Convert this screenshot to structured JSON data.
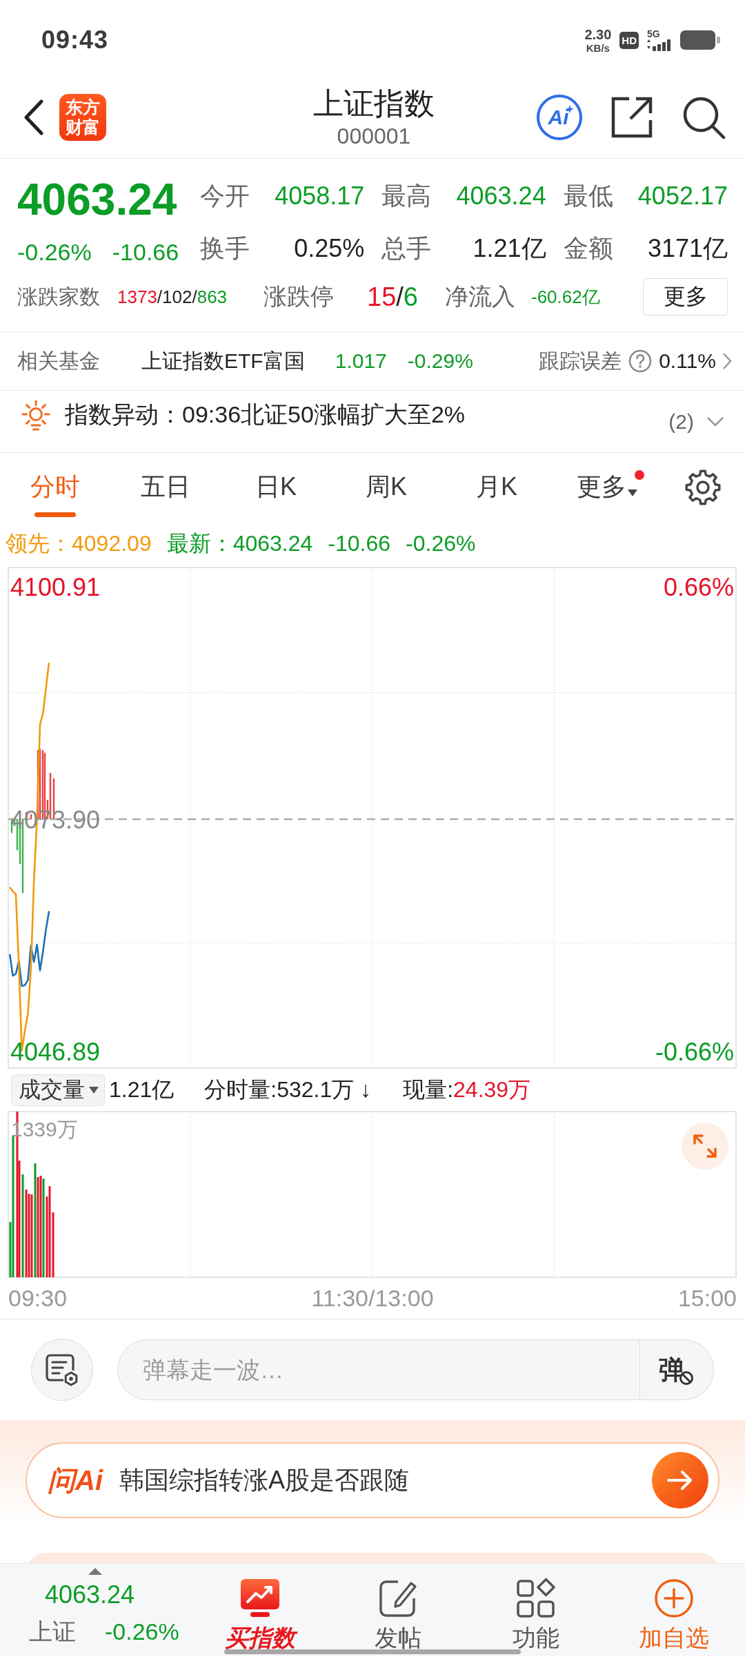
{
  "status_bar": {
    "time": "09:43",
    "net_speed": "2.30",
    "net_unit": "KB/s",
    "hd": "HD",
    "network": "5G"
  },
  "header": {
    "logo": "东方财富",
    "title": "上证指数",
    "code": "000001",
    "ai_label": "Ai"
  },
  "quote": {
    "price": "4063.24",
    "change_pct": "-0.26%",
    "change": "-10.66",
    "kind": "down",
    "stats": [
      {
        "label": "今开",
        "value": "4058.17",
        "kind": "down"
      },
      {
        "label": "最高",
        "value": "4063.24",
        "kind": "down"
      },
      {
        "label": "最低",
        "value": "4052.17",
        "kind": "down"
      },
      {
        "label": "换手",
        "value": "0.25%",
        "kind": "neutral"
      },
      {
        "label": "总手",
        "value": "1.21亿",
        "kind": "neutral"
      },
      {
        "label": "金额",
        "value": "3171亿",
        "kind": "neutral"
      }
    ],
    "breadth": {
      "label": "涨跌家数",
      "parts": [
        {
          "text": "1373",
          "kind": "up"
        },
        {
          "text": "/102/",
          "kind": "neutral"
        },
        {
          "text": "863",
          "kind": "down"
        }
      ]
    },
    "limits": {
      "label": "涨跌停",
      "parts": [
        {
          "text": "15",
          "kind": "up"
        },
        {
          "text": "/",
          "kind": "neutral"
        },
        {
          "text": "6",
          "kind": "down"
        }
      ]
    },
    "net_inflow": {
      "label": "净流入",
      "value": "-60.62亿",
      "kind": "down"
    },
    "more_button": "更多"
  },
  "related_fund": {
    "label": "相关基金",
    "name": "上证指数ETF富国",
    "price": "1.017",
    "change": "-0.29%",
    "kind": "down",
    "tracking_label": "跟踪误差",
    "tracking_value": "0.11%"
  },
  "alert": {
    "text": "指数异动：09:36北证50涨幅扩大至2%",
    "count": "(2)",
    "expanded": false
  },
  "tabs": [
    {
      "label": "分时",
      "selected": true,
      "kind": "period",
      "notification": false
    },
    {
      "label": "五日",
      "selected": false,
      "kind": "period",
      "notification": false
    },
    {
      "label": "日K",
      "selected": false,
      "kind": "period",
      "notification": false
    },
    {
      "label": "周K",
      "selected": false,
      "kind": "period",
      "notification": false
    },
    {
      "label": "月K",
      "selected": false,
      "kind": "period",
      "notification": false
    },
    {
      "label": "更多",
      "selected": false,
      "kind": "menu",
      "notification": true
    }
  ],
  "legend": [
    {
      "text": "领先：4092.09",
      "kind": "lead"
    },
    {
      "text": "最新：4063.24",
      "kind": "down"
    },
    {
      "text": "-10.66",
      "kind": "down"
    },
    {
      "text": "-0.26%",
      "kind": "down"
    }
  ],
  "price_chart": {
    "chart_data": {
      "type": "line",
      "categories": [
        null,
        null,
        null,
        null,
        null,
        null,
        null,
        null,
        null,
        null,
        null,
        null,
        null,
        null,
        null,
        null,
        null,
        null,
        null,
        null,
        null,
        null,
        null,
        null,
        null,
        null,
        null,
        null,
        null,
        null,
        null,
        null,
        null,
        null,
        null,
        null,
        null,
        null,
        null,
        null,
        null,
        null,
        null,
        null,
        null,
        null,
        null,
        null,
        null,
        null,
        null,
        null,
        null,
        null,
        null,
        null,
        null,
        null,
        null,
        null,
        null,
        null,
        null,
        null,
        null,
        null,
        null,
        null,
        null,
        null,
        null,
        null,
        null,
        null,
        null,
        null,
        null,
        null,
        null,
        null,
        null,
        null,
        null,
        null,
        null,
        null,
        null,
        null,
        null,
        null,
        null,
        null,
        null,
        null,
        null,
        null,
        null,
        null,
        null,
        null,
        null,
        null,
        null,
        null,
        null,
        null,
        null,
        null,
        null,
        null,
        null,
        null,
        null,
        null,
        null,
        null,
        null,
        null,
        null,
        null,
        null,
        null,
        null,
        null,
        null,
        null,
        null,
        null,
        null,
        null,
        null,
        null,
        null,
        null,
        null,
        null,
        null,
        null,
        null,
        null,
        null,
        null,
        null,
        null,
        null,
        null,
        null,
        null,
        null,
        null,
        null,
        null,
        null,
        null,
        null,
        null,
        null,
        null,
        null,
        null,
        null,
        null,
        null,
        null,
        null,
        null,
        null,
        null,
        null,
        null,
        null,
        null,
        null,
        null,
        null,
        null,
        null,
        null,
        null,
        null,
        null,
        null,
        null,
        null,
        null,
        null,
        null,
        null,
        null,
        null,
        null,
        null,
        null,
        null,
        null,
        null,
        null,
        null,
        null,
        null,
        null,
        null,
        null,
        null,
        null,
        null,
        null,
        null,
        null,
        null,
        null,
        null,
        null,
        null,
        null,
        null,
        null,
        null,
        null,
        null,
        null,
        null,
        null,
        null,
        null,
        null,
        null,
        null,
        null,
        null,
        null,
        null,
        null,
        null,
        null,
        null,
        null,
        null,
        null,
        null,
        null
      ],
      "series": [
        {
          "color": "#1f6fb5",
          "values": [
            4058.2,
            4055.7,
            4055.9,
            4057.4,
            4054.5,
            4054.6,
            4055.2,
            4059.2,
            4057.3,
            4059.3,
            4056.3,
            4058.5,
            4061.1,
            4063.2,
            null,
            null,
            null,
            null,
            null,
            null,
            null,
            null,
            null,
            null,
            null,
            null,
            null,
            null,
            null,
            null,
            null,
            null,
            null,
            null,
            null,
            null,
            null,
            null,
            null,
            null,
            null,
            null,
            null,
            null,
            null,
            null,
            null,
            null,
            null,
            null,
            null,
            null,
            null,
            null,
            null,
            null,
            null,
            null,
            null,
            null,
            null,
            null,
            null,
            null,
            null,
            null,
            null,
            null,
            null,
            null,
            null,
            null,
            null,
            null,
            null,
            null,
            null,
            null,
            null,
            null,
            null,
            null,
            null,
            null,
            null,
            null,
            null,
            null,
            null,
            null,
            null,
            null,
            null,
            null,
            null,
            null,
            null,
            null,
            null,
            null,
            null,
            null,
            null,
            null,
            null,
            null,
            null,
            null,
            null,
            null,
            null,
            null,
            null,
            null,
            null,
            null,
            null,
            null,
            null,
            null,
            null,
            null,
            null,
            null,
            null,
            null,
            null,
            null,
            null,
            null,
            null,
            null,
            null,
            null,
            null,
            null,
            null,
            null,
            null,
            null,
            null,
            null,
            null,
            null,
            null,
            null,
            null,
            null,
            null,
            null,
            null,
            null,
            null,
            null,
            null,
            null,
            null,
            null,
            null,
            null,
            null,
            null,
            null,
            null,
            null,
            null,
            null,
            null,
            null,
            null,
            null,
            null,
            null,
            null,
            null,
            null,
            null,
            null,
            null,
            null,
            null,
            null,
            null,
            null,
            null,
            null,
            null,
            null,
            null,
            null,
            null,
            null,
            null,
            null,
            null,
            null,
            null,
            null,
            null,
            null,
            null,
            null,
            null,
            null,
            null,
            null,
            null,
            null,
            null,
            null,
            null,
            null,
            null,
            null,
            null,
            null,
            null,
            null,
            null,
            null,
            null,
            null,
            null,
            null,
            null,
            null,
            null,
            null,
            null,
            null,
            null,
            null,
            null,
            null,
            null,
            null,
            null,
            null,
            null,
            null,
            null
          ]
        },
        {
          "color": "#f29a0c",
          "values": [
            4066.0,
            4065.5,
            4065.2,
            4057.0,
            4047.0,
            4049.3,
            4051.3,
            4056.5,
            4066.7,
            4073.9,
            4084.9,
            4086.2,
            4089.2,
            4092.1,
            null,
            null,
            null,
            null,
            null,
            null,
            null,
            null,
            null,
            null,
            null,
            null,
            null,
            null,
            null,
            null,
            null,
            null,
            null,
            null,
            null,
            null,
            null,
            null,
            null,
            null,
            null,
            null,
            null,
            null,
            null,
            null,
            null,
            null,
            null,
            null,
            null,
            null,
            null,
            null,
            null,
            null,
            null,
            null,
            null,
            null,
            null,
            null,
            null,
            null,
            null,
            null,
            null,
            null,
            null,
            null,
            null,
            null,
            null,
            null,
            null,
            null,
            null,
            null,
            null,
            null,
            null,
            null,
            null,
            null,
            null,
            null,
            null,
            null,
            null,
            null,
            null,
            null,
            null,
            null,
            null,
            null,
            null,
            null,
            null,
            null,
            null,
            null,
            null,
            null,
            null,
            null,
            null,
            null,
            null,
            null,
            null,
            null,
            null,
            null,
            null,
            null,
            null,
            null,
            null,
            null,
            null,
            null,
            null,
            null,
            null,
            null,
            null,
            null,
            null,
            null,
            null,
            null,
            null,
            null,
            null,
            null,
            null,
            null,
            null,
            null,
            null,
            null,
            null,
            null,
            null,
            null,
            null,
            null,
            null,
            null,
            null,
            null,
            null,
            null,
            null,
            null,
            null,
            null,
            null,
            null,
            null,
            null,
            null,
            null,
            null,
            null,
            null,
            null,
            null,
            null,
            null,
            null,
            null,
            null,
            null,
            null,
            null,
            null,
            null,
            null,
            null,
            null,
            null,
            null,
            null,
            null,
            null,
            null,
            null,
            null,
            null,
            null,
            null,
            null,
            null,
            null,
            null,
            null,
            null,
            null,
            null,
            null,
            null,
            null,
            null,
            null,
            null,
            null,
            null,
            null,
            null,
            null,
            null,
            null,
            null,
            null,
            null,
            null,
            null,
            null,
            null,
            null,
            null,
            null,
            null,
            null,
            null,
            null,
            null,
            null,
            null,
            null,
            null,
            null,
            null,
            null,
            null,
            null,
            null,
            null,
            null
          ]
        }
      ],
      "ylim": [
        4044.96,
        4103.16
      ],
      "yticks": [
        {
          "value": 4046.89,
          "label": "4046.89"
        },
        {
          "value": 4073.9,
          "label": "4073.90"
        },
        {
          "value": 4100.91,
          "label": "4100.91"
        }
      ],
      "ref_lines": [
        {
          "axis": "y",
          "value": 4073.9
        }
      ]
    },
    "percent_labels": [
      {
        "text": "0.66%",
        "kind": "up"
      },
      {
        "text": "-0.66%",
        "kind": "down"
      }
    ]
  },
  "volume": {
    "selector": "成交量",
    "total": "1.21亿",
    "minute_volume": "分时量:532.1万 ↓",
    "current": {
      "label": "现量:",
      "value": "24.39万",
      "kind": "up"
    },
    "max_label": "1339万",
    "time_axis": [
      "09:30",
      "11:30/13:00",
      "15:00"
    ]
  },
  "comment_bar": {
    "placeholder": "弹幕走一波…",
    "toggle_label": "弹"
  },
  "ask_ai": {
    "logo": "问Ai",
    "question": "韩国综指转涨A股是否跟随"
  },
  "bottom_nav": {
    "index_price": "4063.24",
    "index_name": "上证",
    "index_change": "-0.26%",
    "kind": "down",
    "items": [
      {
        "label": "买指数",
        "kind": "buy"
      },
      {
        "label": "发帖",
        "kind": "post"
      },
      {
        "label": "功能",
        "kind": "tools"
      },
      {
        "label": "加自选",
        "kind": "add"
      }
    ]
  }
}
